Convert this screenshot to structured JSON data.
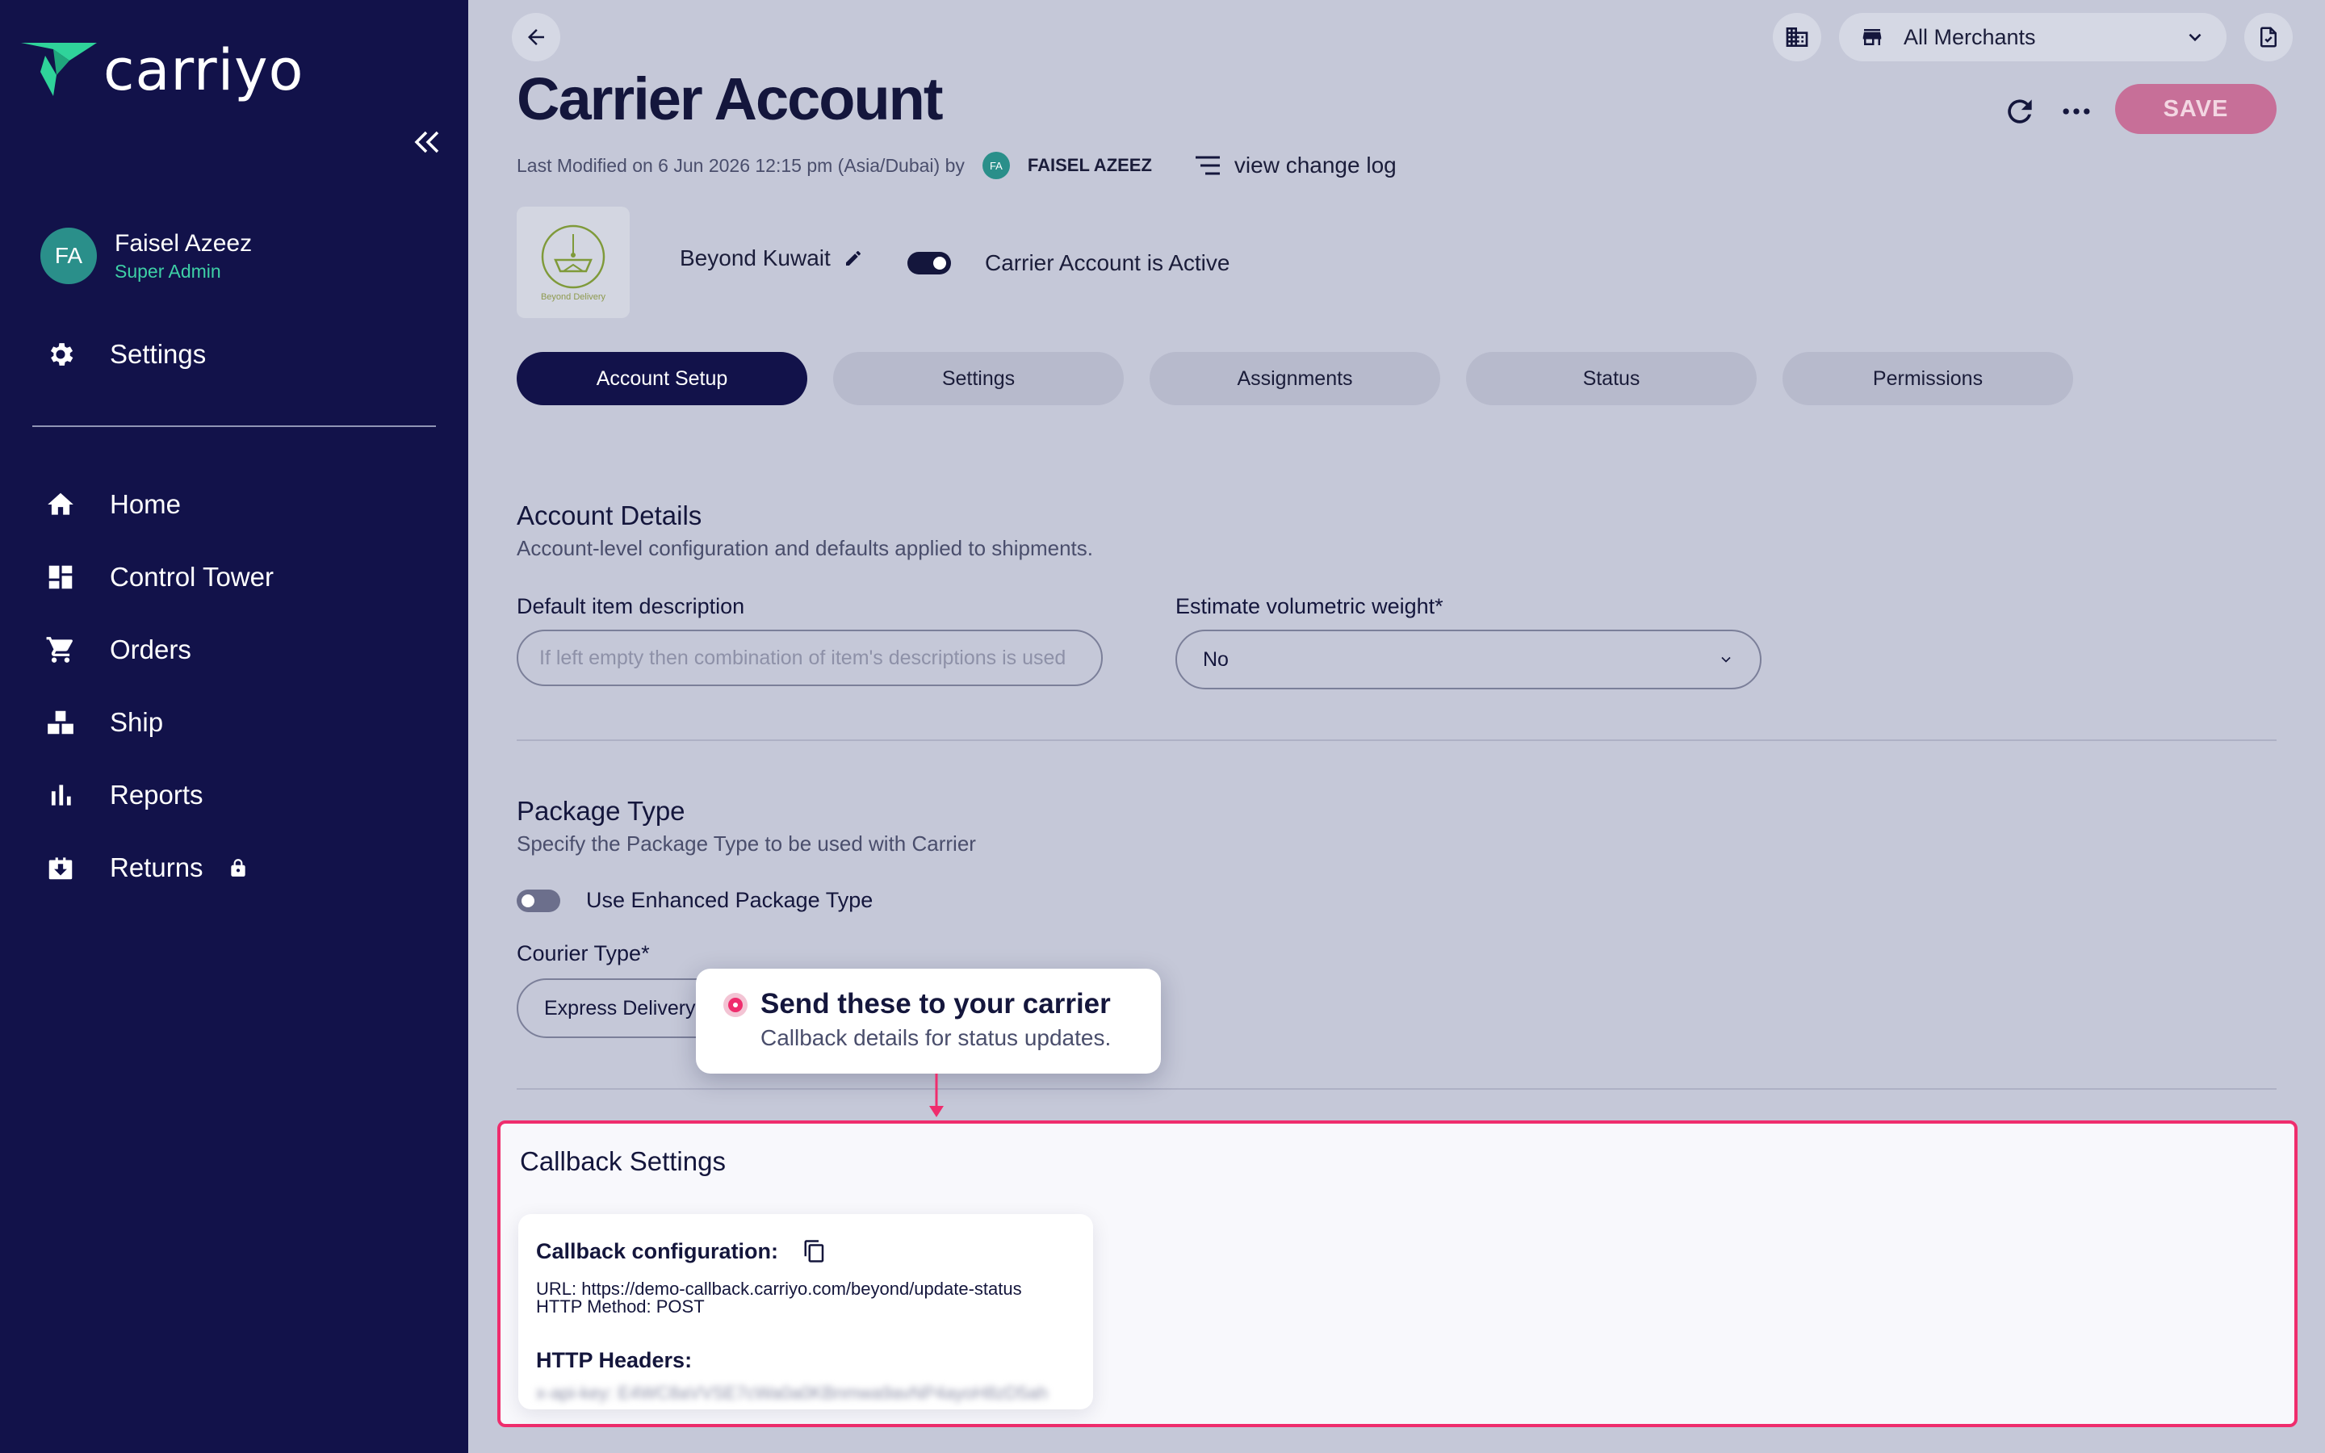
{
  "sidebar": {
    "logo_text": "carriyo",
    "user": {
      "initials": "FA",
      "name": "Faisel Azeez",
      "role": "Super Admin"
    },
    "settings_label": "Settings",
    "nav": [
      {
        "label": "Home",
        "icon": "home-icon"
      },
      {
        "label": "Control Tower",
        "icon": "dashboard-icon"
      },
      {
        "label": "Orders",
        "icon": "cart-icon"
      },
      {
        "label": "Ship",
        "icon": "boxes-icon"
      },
      {
        "label": "Reports",
        "icon": "bar-chart-icon"
      },
      {
        "label": "Returns",
        "icon": "return-box-icon",
        "locked": true
      }
    ]
  },
  "header": {
    "merchant_select": "All Merchants",
    "title": "Carrier Account",
    "save_label": "SAVE",
    "meta": {
      "modified": "Last Modified on 6 Jun 2026 12:15 pm (Asia/Dubai) by",
      "author_initials": "FA",
      "author": "FAISEL AZEEZ",
      "changelog": "view change log"
    }
  },
  "carrier": {
    "logo_caption": "Beyond Delivery",
    "name": "Beyond Kuwait",
    "status_label": "Carrier Account is Active"
  },
  "tabs": [
    "Account Setup",
    "Settings",
    "Assignments",
    "Status",
    "Permissions"
  ],
  "account_details": {
    "title": "Account Details",
    "subtitle": "Account-level configuration and defaults applied to shipments.",
    "item_desc_label": "Default item description",
    "item_desc_placeholder": "If left empty then combination of item's descriptions is used",
    "volumetric_label": "Estimate volumetric weight*",
    "volumetric_value": "No"
  },
  "package_type": {
    "title": "Package Type",
    "subtitle": "Specify the Package Type to be used with Carrier",
    "enhanced_label": "Use Enhanced Package Type",
    "courier_label": "Courier Type*",
    "courier_value": "Express Delivery"
  },
  "tooltip": {
    "title": "Send these to your carrier",
    "subtitle": "Callback details for status updates."
  },
  "callback": {
    "title": "Callback Settings",
    "config_label": "Callback configuration:",
    "url_line": "URL: https://demo-callback.carriyo.com/beyond/update-status",
    "method_line": "HTTP Method: POST",
    "headers_label": "HTTP Headers:",
    "headers_value": "x-api-key: E4WC8aVVSE7cWa0a0KBnmwa9avNP4ayoH8zD5ah"
  },
  "colors": {
    "sidebar": "#12124a",
    "accent": "#ef2d6d",
    "save": "#c76f98",
    "brand_green": "#2fd39a"
  }
}
